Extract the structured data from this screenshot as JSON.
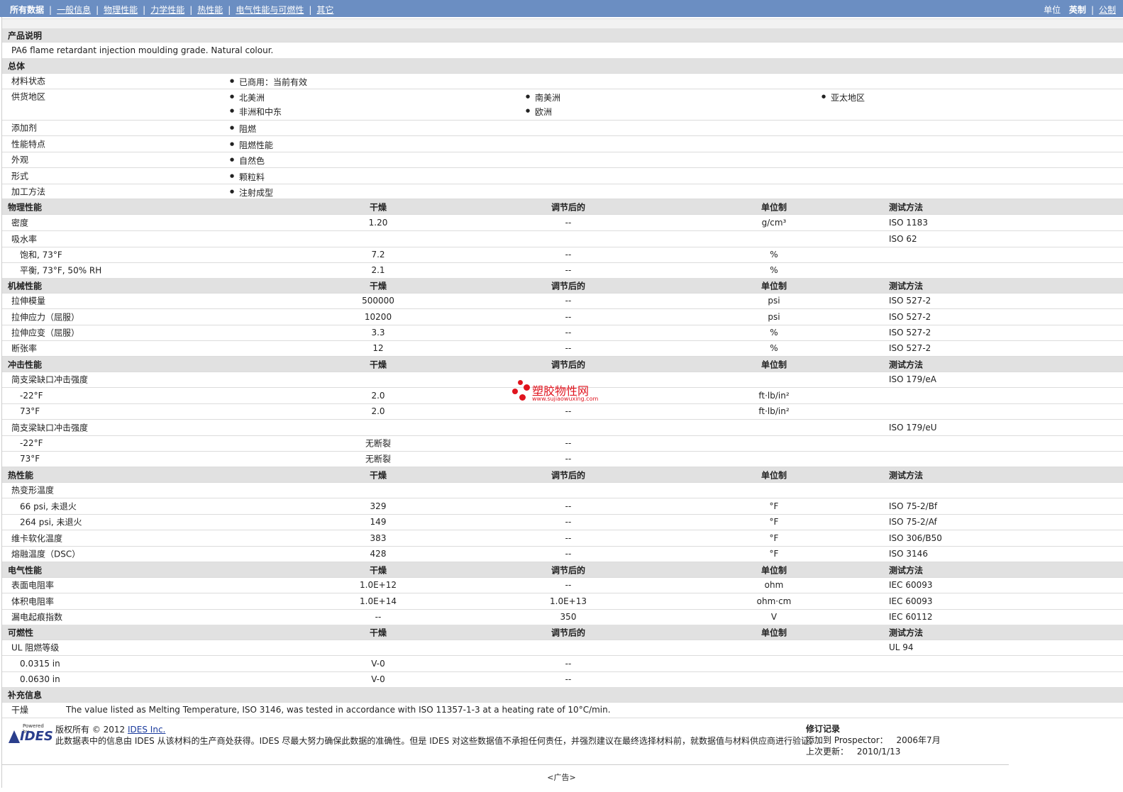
{
  "nav": {
    "active": "所有数据",
    "links": [
      "一般信息",
      "物理性能",
      "力学性能",
      "热性能",
      "电气性能与可燃性",
      "其它"
    ],
    "units_label": "单位",
    "units_active": "英制",
    "units_other": "公制"
  },
  "header_cols": [
    "干燥",
    "调节后的",
    "单位制",
    "测试方法"
  ],
  "product_desc": {
    "title": "产品说明",
    "text": "PA6 flame retardant injection moulding grade. Natural colour."
  },
  "general": {
    "title": "总体",
    "rows": [
      {
        "label": "材料状态",
        "items": [
          "已商用：当前有效"
        ]
      },
      {
        "label": "供货地区",
        "items": [
          "北美洲",
          "南美洲",
          "亚太地区",
          "非洲和中东",
          "欧洲"
        ]
      },
      {
        "label": "添加剂",
        "items": [
          "阻燃"
        ]
      },
      {
        "label": "性能特点",
        "items": [
          "阻燃性能"
        ]
      },
      {
        "label": "外观",
        "items": [
          "自然色"
        ]
      },
      {
        "label": "形式",
        "items": [
          "颗粒料"
        ]
      },
      {
        "label": "加工方法",
        "items": [
          "注射成型"
        ]
      }
    ]
  },
  "sections": {
    "physical": {
      "title": "物理性能",
      "rows": [
        {
          "label": "密度",
          "dry": "1.20",
          "cond": "--",
          "unit": "g/cm³",
          "method": "ISO 1183"
        },
        {
          "label": "吸水率",
          "dry": "",
          "cond": "",
          "unit": "",
          "method": "ISO 62"
        },
        {
          "label": "饱和, 73°F",
          "dry": "7.2",
          "cond": "--",
          "unit": "%",
          "method": ""
        },
        {
          "label": "平衡, 73°F, 50% RH",
          "dry": "2.1",
          "cond": "--",
          "unit": "%",
          "method": ""
        }
      ]
    },
    "mechanical": {
      "title": "机械性能",
      "rows": [
        {
          "label": "拉伸模量",
          "dry": "500000",
          "cond": "--",
          "unit": "psi",
          "method": "ISO 527-2"
        },
        {
          "label": "拉伸应力（屈服）",
          "dry": "10200",
          "cond": "--",
          "unit": "psi",
          "method": "ISO 527-2"
        },
        {
          "label": "拉伸应变（屈服）",
          "dry": "3.3",
          "cond": "--",
          "unit": "%",
          "method": "ISO 527-2"
        },
        {
          "label": "断张率",
          "dry": "12",
          "cond": "--",
          "unit": "%",
          "method": "ISO 527-2"
        }
      ]
    },
    "impact": {
      "title": "冲击性能",
      "rows": [
        {
          "label": "简支梁缺口冲击强度",
          "dry": "",
          "cond": "",
          "unit": "",
          "method": "ISO 179/eA"
        },
        {
          "label": "-22°F",
          "dry": "2.0",
          "cond": "",
          "unit": "ft·lb/in²",
          "method": ""
        },
        {
          "label": "73°F",
          "dry": "2.0",
          "cond": "--",
          "unit": "ft·lb/in²",
          "method": ""
        },
        {
          "label": "简支梁缺口冲击强度",
          "dry": "",
          "cond": "",
          "unit": "",
          "method": "ISO 179/eU"
        },
        {
          "label": "-22°F",
          "dry": "无断裂",
          "cond": "--",
          "unit": "",
          "method": ""
        },
        {
          "label": "73°F",
          "dry": "无断裂",
          "cond": "--",
          "unit": "",
          "method": ""
        }
      ]
    },
    "thermal": {
      "title": "热性能",
      "rows": [
        {
          "label": "热变形温度",
          "dry": "",
          "cond": "",
          "unit": "",
          "method": ""
        },
        {
          "label": "66 psi, 未退火",
          "dry": "329",
          "cond": "--",
          "unit": "°F",
          "method": "ISO 75-2/Bf"
        },
        {
          "label": "264 psi, 未退火",
          "dry": "149",
          "cond": "--",
          "unit": "°F",
          "method": "ISO 75-2/Af"
        },
        {
          "label": "维卡软化温度",
          "dry": "383",
          "cond": "--",
          "unit": "°F",
          "method": "ISO 306/B50"
        },
        {
          "label": "熔融温度（DSC）",
          "dry": "428",
          "cond": "--",
          "unit": "°F",
          "method": "ISO 3146"
        }
      ]
    },
    "electrical": {
      "title": "电气性能",
      "rows": [
        {
          "label": "表面电阻率",
          "dry": "1.0E+12",
          "cond": "--",
          "unit": "ohm",
          "method": "IEC 60093"
        },
        {
          "label": "体积电阻率",
          "dry": "1.0E+14",
          "cond": "1.0E+13",
          "unit": "ohm·cm",
          "method": "IEC 60093"
        },
        {
          "label": "漏电起痕指数",
          "dry": "--",
          "cond": "350",
          "unit": "V",
          "method": "IEC 60112"
        }
      ]
    },
    "flammability": {
      "title": "可燃性",
      "rows": [
        {
          "label": "UL 阻燃等级",
          "dry": "",
          "cond": "",
          "unit": "",
          "method": "UL 94"
        },
        {
          "label": "0.0315 in",
          "dry": "V-0",
          "cond": "--",
          "unit": "",
          "method": ""
        },
        {
          "label": "0.0630 in",
          "dry": "V-0",
          "cond": "--",
          "unit": "",
          "method": ""
        }
      ]
    }
  },
  "supplement": {
    "title": "补充信息",
    "label": "干燥",
    "text": "The value listed as Melting Temperature, ISO 3146, was tested in accordance with ISO 11357-1-3 at a heating rate of 10°C/min."
  },
  "watermark": {
    "name": "塑胶物性网",
    "url": "www.sujiaowuxing.com"
  },
  "footer": {
    "logo_powered": "Powered by",
    "logo_text": "IDES",
    "copyright_prefix": "版权所有 © 2012",
    "company": "IDES Inc.",
    "disclaimer": "此数据表中的信息由 IDES 从该材料的生产商处获得。IDES 尽最大努力确保此数据的准确性。但是 IDES 对这些数据值不承担任何责任，并强烈建议在最终选择材料前，就数据值与材料供应商进行验证。",
    "rev_title": "修订记录",
    "added_label": "添加到 Prospector：",
    "added_value": "2006年7月",
    "updated_label": "上次更新：",
    "updated_value": "2010/1/13"
  },
  "ad_label": "<广告>"
}
